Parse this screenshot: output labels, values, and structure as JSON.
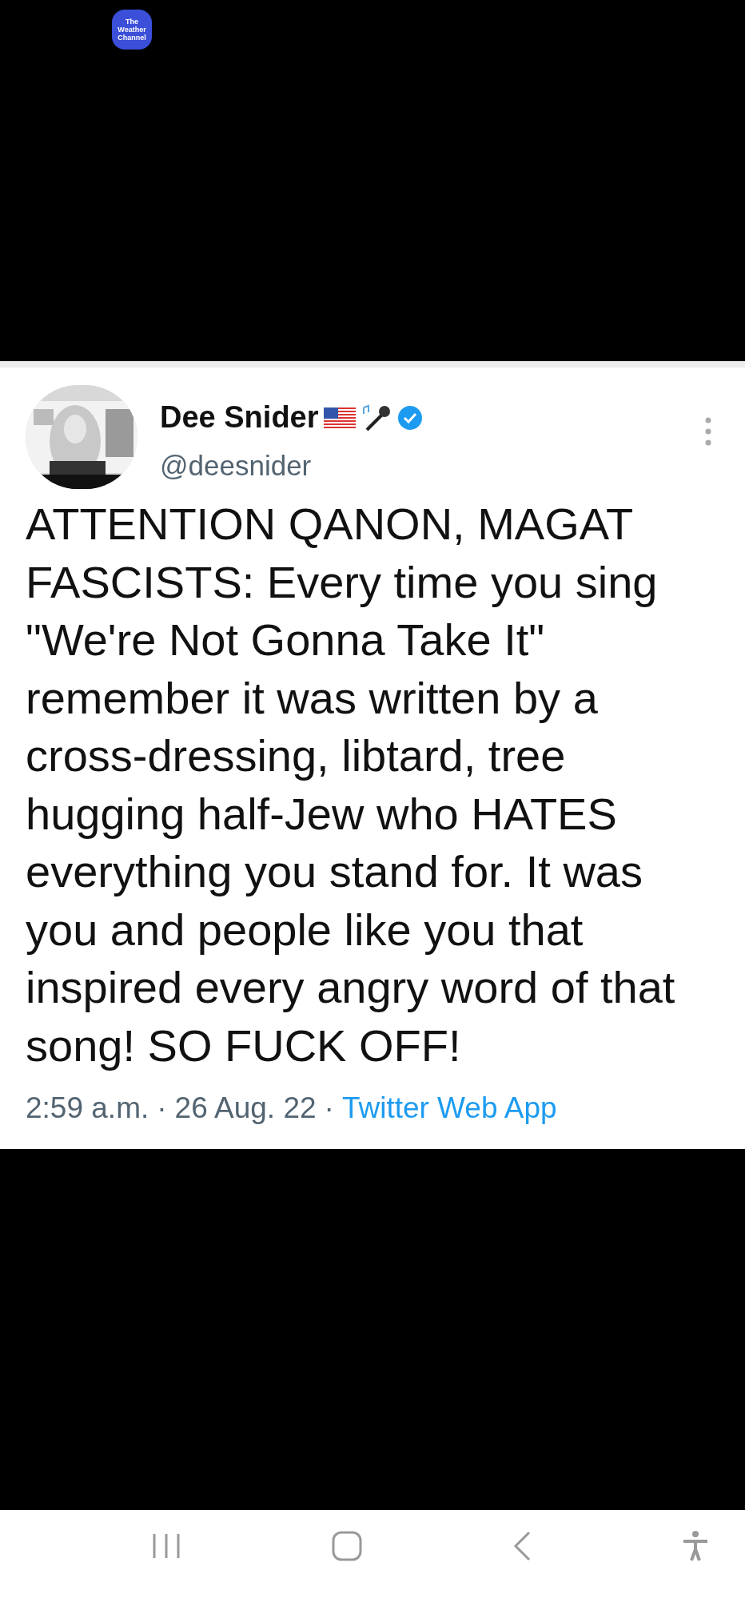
{
  "app_logo": {
    "text": "The Weather Channel"
  },
  "tweet": {
    "name": "Dee Snider",
    "handle": "@deesnider",
    "text_lines": [
      "ATTENTION QANON, MAGAT",
      "FASCISTS: Every time you sing",
      "\"We're Not Gonna Take It\"",
      "remember it was written by a",
      "cross-dressing, libtard, tree",
      "hugging half-Jew who HATES",
      "everything you stand for. It was",
      "you and people like you that",
      "inspired every angry word of that",
      "song! SO FUCK OFF!"
    ],
    "time": "2:59 a.m.",
    "separator": "·",
    "date": "26 Aug. 22",
    "source": "Twitter Web App"
  }
}
